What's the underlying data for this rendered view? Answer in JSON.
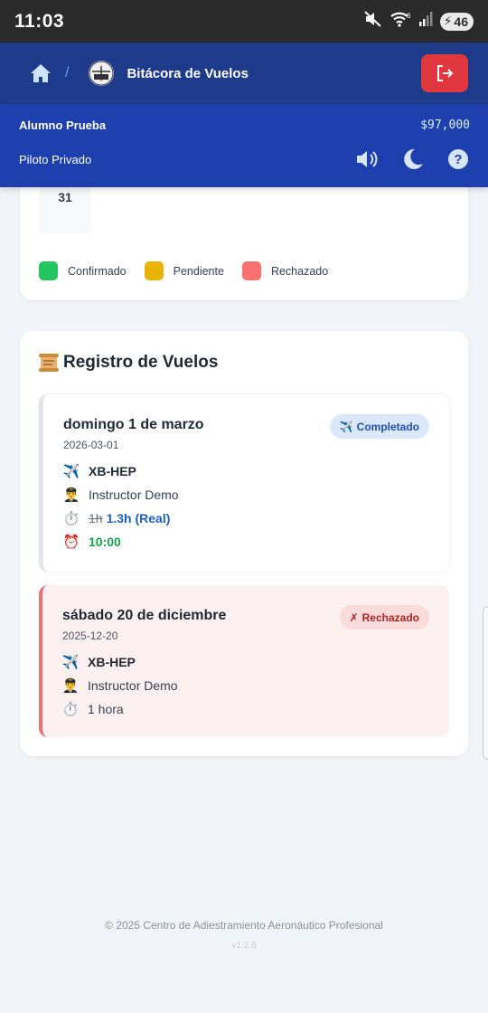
{
  "status_bar": {
    "time": "11:03",
    "battery": "46",
    "wifi_badge": "6"
  },
  "header": {
    "title": "Bitácora de Vuelos"
  },
  "user": {
    "name": "Alumno Prueba",
    "balance": "$97,000",
    "license": "Piloto Privado"
  },
  "calendar": {
    "visible_day": "31",
    "legend": [
      {
        "label": "Confirmado",
        "color": "#22c55e"
      },
      {
        "label": "Pendiente",
        "color": "#eab308"
      },
      {
        "label": "Rechazado",
        "color": "#f87171"
      }
    ]
  },
  "log": {
    "title": "Registro de Vuelos",
    "flights": [
      {
        "date": "domingo 1 de marzo",
        "iso": "2026-03-01",
        "status": "Completado",
        "aircraft": "XB-HEP",
        "instructor": "Instructor Demo",
        "planned": "1h",
        "actual": "1.3h (Real)",
        "time": "10:00"
      },
      {
        "date": "sábado 20 de diciembre",
        "iso": "2025-12-20",
        "status": "Rechazado",
        "status_symbol": "✗",
        "aircraft": "XB-HEP",
        "instructor": "Instructor Demo",
        "duration": "1 hora"
      }
    ]
  },
  "footer": {
    "copyright": "© 2025 Centro de Adiestramiento Aeronáutico Profesional",
    "version": "v1.2.6"
  },
  "colors": {
    "header": "#1e3a8a",
    "userbar": "#1e40af",
    "logout": "#e0383e"
  }
}
